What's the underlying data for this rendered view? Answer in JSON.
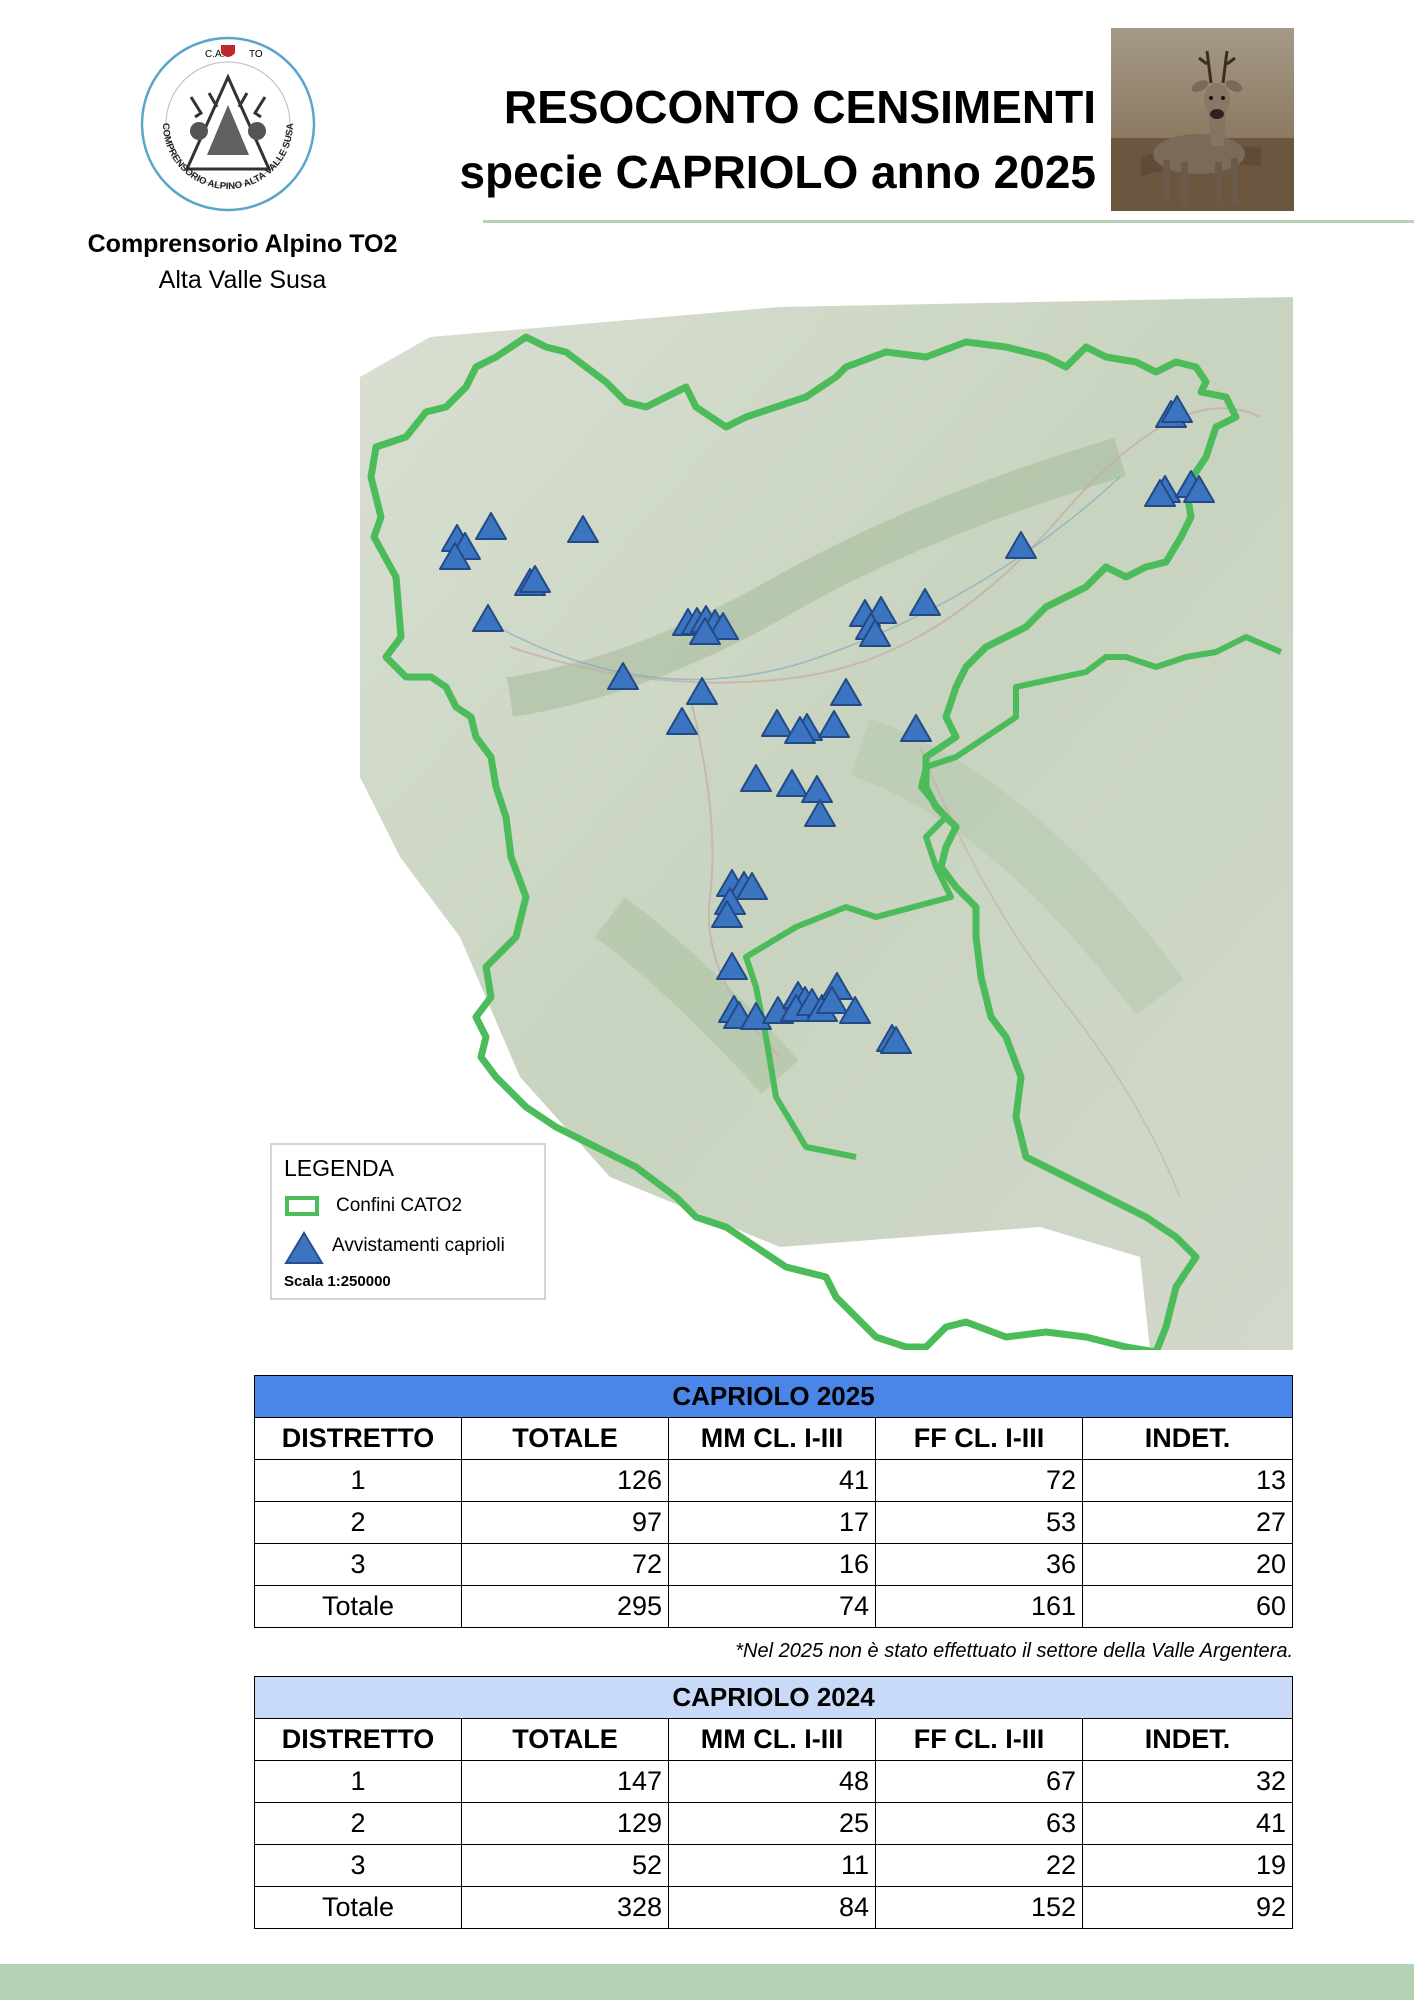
{
  "header": {
    "logo": {
      "text_top": "C.A.",
      "text_right": "TO",
      "ring_text": "COMPRENSORIO ALPINO ALTA VALLE SUSA"
    },
    "org_name": "Comprensorio Alpino TO2",
    "org_sub": "Alta Valle Susa",
    "title_line1": "RESOCONTO CENSIMENTI",
    "title_line2": "specie CAPRIOLO anno 2025"
  },
  "legend": {
    "title": "LEGENDA",
    "boundary_label": "Confini CATO2",
    "sightings_label": "Avvistamenti caprioli",
    "scale": "Scala 1:250000"
  },
  "colors": {
    "boundary": "#4cbb5a",
    "marker": "#3b74c0",
    "header_2025": "#4a86e8",
    "header_2024": "#c9daf8",
    "footer": "#b3d1b3"
  },
  "tables": [
    {
      "caption": "CAPRIOLO 2025",
      "columns": [
        "DISTRETTO",
        "TOTALE",
        "MM CL. I-III",
        "FF CL. I-III",
        "INDET."
      ],
      "rows": [
        [
          "1",
          "126",
          "41",
          "72",
          "13"
        ],
        [
          "2",
          "97",
          "17",
          "53",
          "27"
        ],
        [
          "3",
          "72",
          "16",
          "36",
          "20"
        ],
        [
          "Totale",
          "295",
          "74",
          "161",
          "60"
        ]
      ]
    },
    {
      "caption": "CAPRIOLO 2024",
      "columns": [
        "DISTRETTO",
        "TOTALE",
        "MM CL. I-III",
        "FF CL. I-III",
        "INDET."
      ],
      "rows": [
        [
          "1",
          "147",
          "48",
          "67",
          "32"
        ],
        [
          "2",
          "129",
          "25",
          "63",
          "41"
        ],
        [
          "3",
          "52",
          "11",
          "22",
          "19"
        ],
        [
          "Totale",
          "328",
          "84",
          "152",
          "92"
        ]
      ]
    }
  ],
  "note": "*Nel 2025 non è stato effettuato il settore della Valle Argentera."
}
